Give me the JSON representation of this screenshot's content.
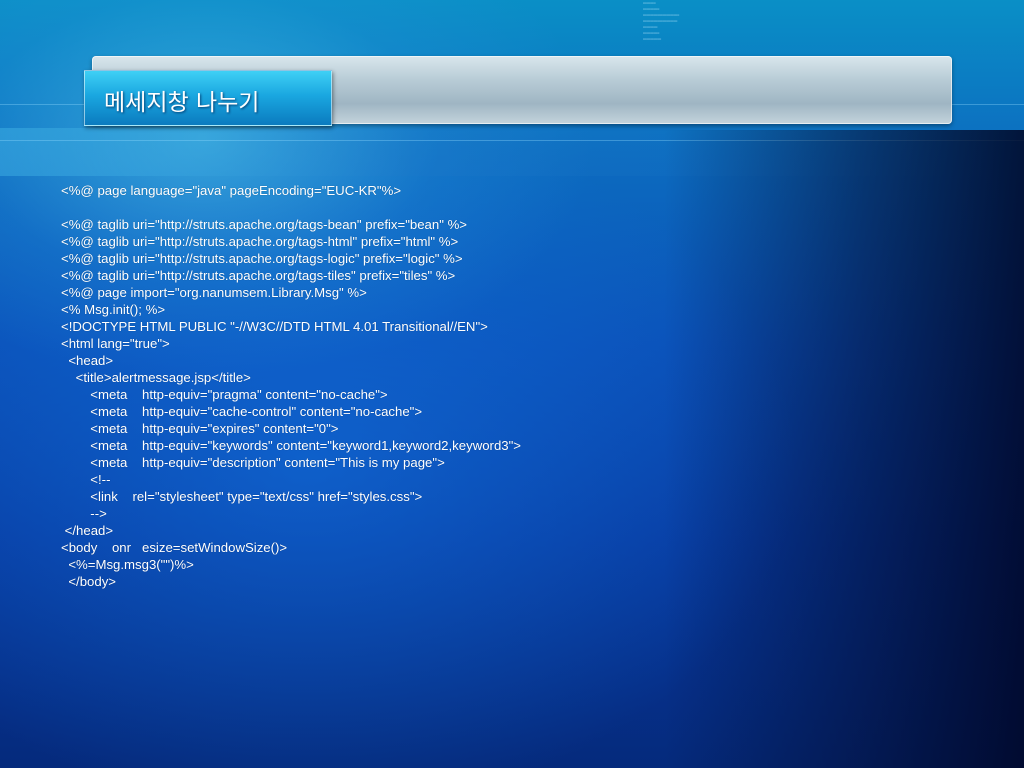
{
  "slide": {
    "title": "메세지창 나누기"
  },
  "code": {
    "lines": [
      "<%@ page language=\"java\" pageEncoding=\"EUC-KR\"%>",
      "",
      "<%@ taglib uri=\"http://struts.apache.org/tags-bean\" prefix=\"bean\" %>",
      "<%@ taglib uri=\"http://struts.apache.org/tags-html\" prefix=\"html\" %>",
      "<%@ taglib uri=\"http://struts.apache.org/tags-logic\" prefix=\"logic\" %>",
      "<%@ taglib uri=\"http://struts.apache.org/tags-tiles\" prefix=\"tiles\" %>",
      "<%@ page import=\"org.nanumsem.Library.Msg\" %>",
      "<% Msg.init(); %>",
      "<!DOCTYPE HTML PUBLIC \"-//W3C//DTD HTML 4.01 Transitional//EN\">",
      "<html lang=\"true\">",
      "  <head>",
      "    <title>alertmessage.jsp</title>",
      "        <meta    http-equiv=\"pragma\" content=\"no-cache\">",
      "        <meta    http-equiv=\"cache-control\" content=\"no-cache\">",
      "        <meta    http-equiv=\"expires\" content=\"0\">",
      "        <meta    http-equiv=\"keywords\" content=\"keyword1,keyword2,keyword3\">",
      "        <meta    http-equiv=\"description\" content=\"This is my page\">",
      "        <!--",
      "        <link    rel=\"stylesheet\" type=\"text/css\" href=\"styles.css\">",
      "        -->",
      " </head>",
      "<body    onr   esize=setWindowSize()>",
      "  <%=Msg.msg3(\"\")%>",
      "  </body>"
    ]
  },
  "colors": {
    "background_top": "#0a8fc6",
    "background_bottom": "#052a7c",
    "title_tab": "#1aa7e0",
    "title_bar": "#b8ccd6",
    "text": "#ffffff"
  }
}
